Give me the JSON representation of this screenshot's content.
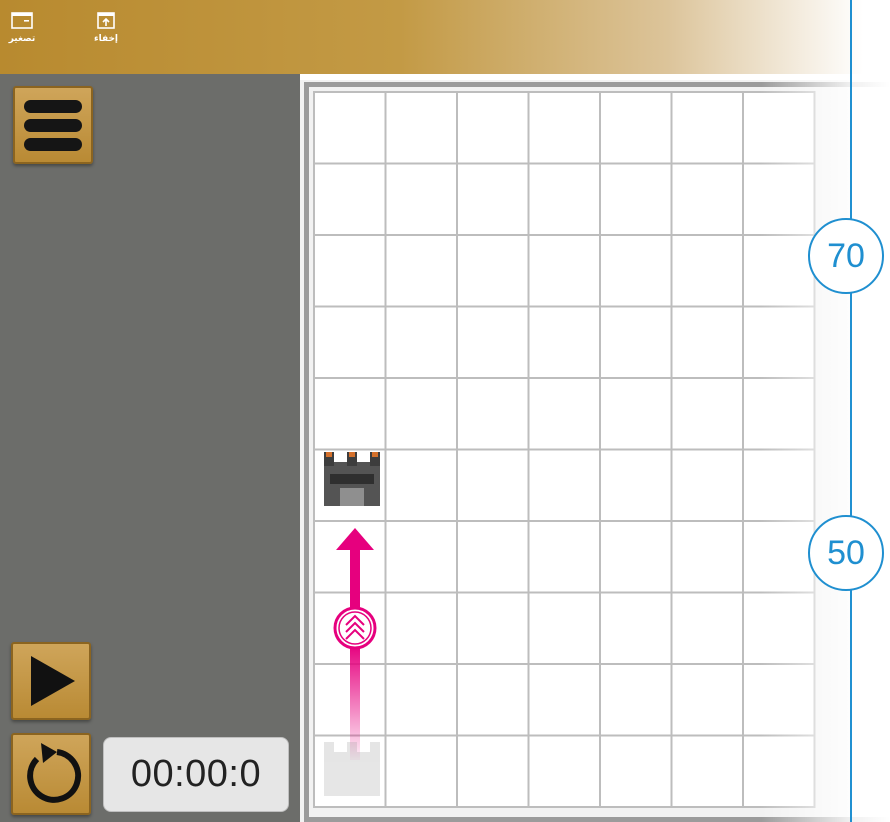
{
  "toolbar": {
    "minimize_label": "تصغير",
    "hide_label": "إخفاء"
  },
  "sidebar": {
    "menu_icon": "hamburger-icon",
    "play_icon": "play-icon",
    "reset_icon": "reset-icon"
  },
  "timer": {
    "value": "00:00:0"
  },
  "board": {
    "rows": 10,
    "cols": 7,
    "robot_position": {
      "row": 6,
      "col": 1
    },
    "robot_start": {
      "row": 10,
      "col": 1
    },
    "move_icon": "double-chevron-up-icon"
  },
  "ruler": {
    "markers": [
      "70",
      "50"
    ]
  },
  "colors": {
    "toolbar": "#b88a2f",
    "panel": "#6c6d6a",
    "button": "#c19645",
    "path": "#e6007e",
    "ruler": "#1f8fd0"
  }
}
